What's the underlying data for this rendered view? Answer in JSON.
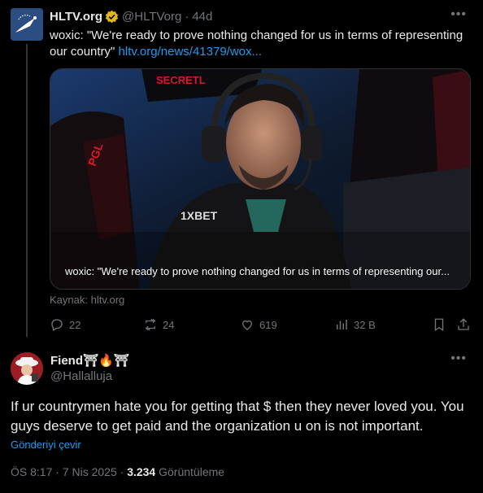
{
  "post1": {
    "author_name": "HLTV.org",
    "handle": "@HLTVorg",
    "time": "44d",
    "separator": "·",
    "text": "woxic: \"We're ready to prove nothing changed for us in terms of representing our country\" ",
    "link_text": "hltv.org/news/41379/wox...",
    "media_caption": "woxic: \"We're ready to prove nothing changed for us in terms of representing our...",
    "source": "Kaynak: hltv.org",
    "replies": "22",
    "reposts": "24",
    "likes": "619",
    "views": "32 B",
    "icons": [
      "reply-icon",
      "repost-icon",
      "like-icon",
      "views-icon",
      "bookmark-icon",
      "share-icon"
    ]
  },
  "post2": {
    "author_name": "Fiend⛩🔥⛩",
    "handle": "@Hallalluja",
    "text": "If ur countrymen hate you for getting that $ then they never loved you. You guys deserve to get paid and the organization u on is not important.",
    "translate_label": "Gönderiyi çevir",
    "timestamp": "ÖS 8:17 · 7 Nis 2025 · ",
    "view_count": "3.234",
    "views_label": " Görüntüleme"
  },
  "colors": {
    "background": "#000000",
    "text_primary": "#e7e9ea",
    "text_secondary": "#71767b",
    "link": "#1d9bf0",
    "verified_badge": "#e2b719"
  }
}
